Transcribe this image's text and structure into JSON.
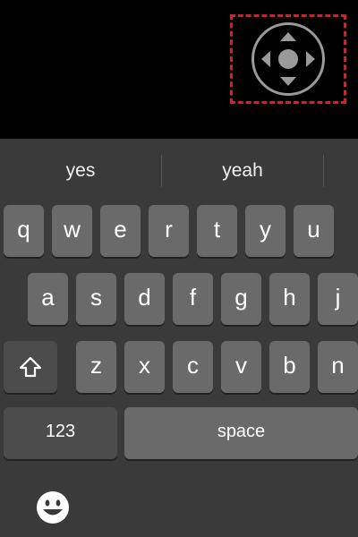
{
  "controls": {
    "dpad_label": "d-pad",
    "highlight_color": "#c8262d"
  },
  "suggestions": [
    "yes",
    "yeah"
  ],
  "keyboard": {
    "row1": [
      "q",
      "w",
      "e",
      "r",
      "t",
      "y",
      "u"
    ],
    "row2": [
      "a",
      "s",
      "d",
      "f",
      "g",
      "h",
      "j"
    ],
    "row3": [
      "z",
      "x",
      "c",
      "v",
      "b",
      "n"
    ],
    "numbers_key": "123",
    "space_key": "space",
    "shift_icon": "shift-icon",
    "emoji_icon": "emoji-icon"
  }
}
